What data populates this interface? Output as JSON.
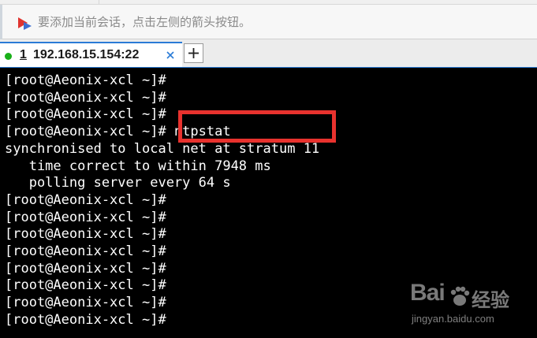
{
  "session_bar": {
    "hint": "要添加当前会话，点击左侧的箭头按钮。"
  },
  "tabs": [
    {
      "number": "1",
      "title": "192.168.15.154:22",
      "status_color": "#19b019"
    }
  ],
  "terminal": {
    "lines": [
      "[root@Aeonix-xcl ~]#",
      "[root@Aeonix-xcl ~]#",
      "[root@Aeonix-xcl ~]#",
      "[root@Aeonix-xcl ~]# ntpstat",
      "synchronised to local net at stratum 11",
      "   time correct to within 7948 ms",
      "   polling server every 64 s",
      "[root@Aeonix-xcl ~]#",
      "[root@Aeonix-xcl ~]#",
      "[root@Aeonix-xcl ~]#",
      "[root@Aeonix-xcl ~]#",
      "[root@Aeonix-xcl ~]#",
      "[root@Aeonix-xcl ~]#",
      "[root@Aeonix-xcl ~]#",
      "[root@Aeonix-xcl ~]#"
    ],
    "highlight_color": "#e8322e"
  },
  "watermark": {
    "logo": "Bai",
    "logo_suffix": "经验",
    "url": "jingyan.baidu.com"
  },
  "colors": {
    "accent": "#2a7bd6",
    "terminal_bg": "#000000",
    "terminal_fg": "#ffffff"
  }
}
